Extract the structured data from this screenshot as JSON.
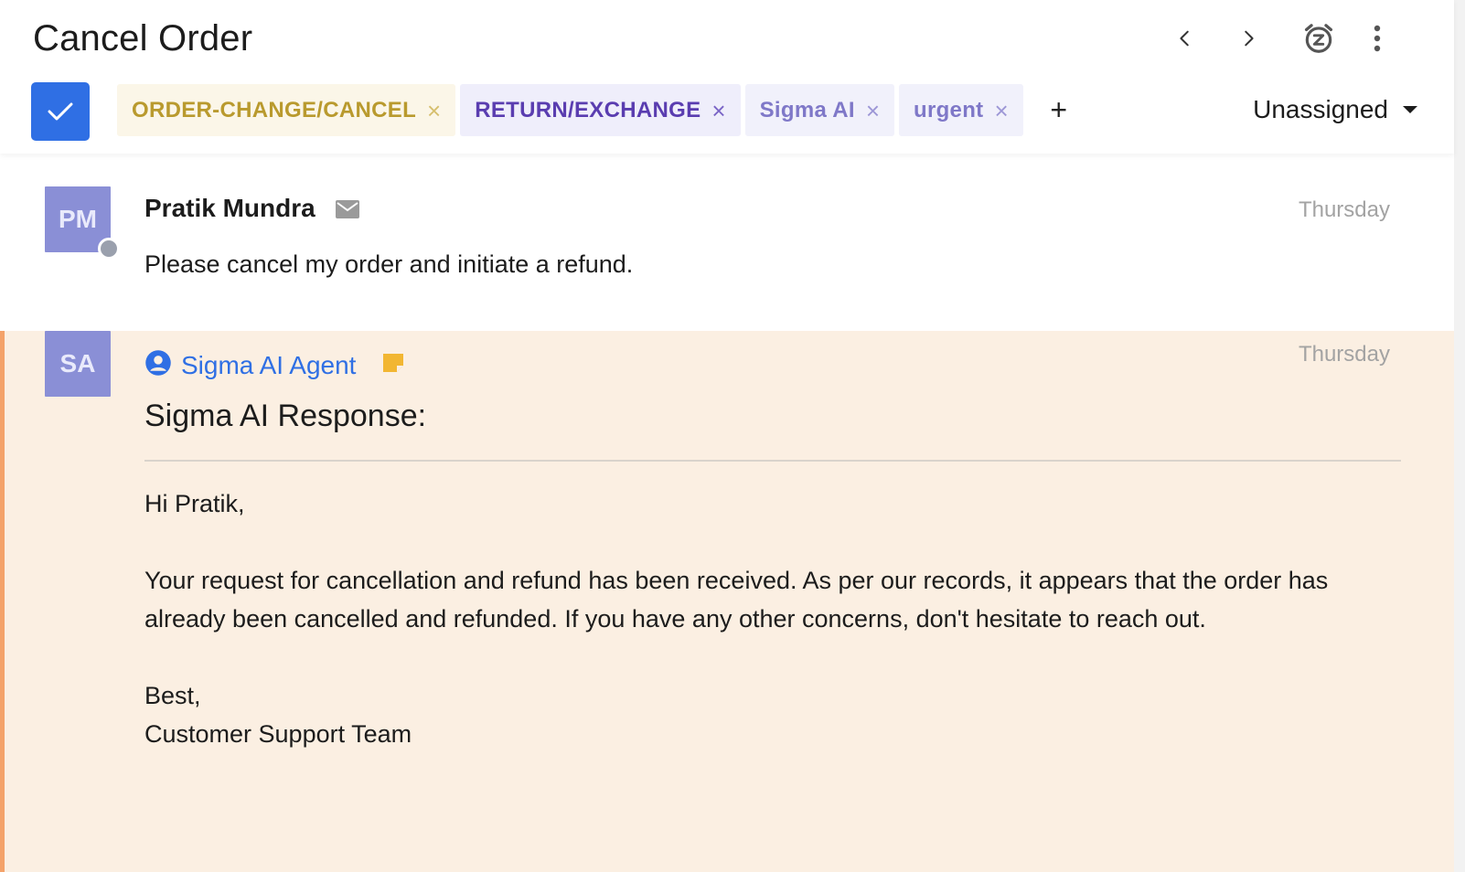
{
  "header": {
    "title": "Cancel Order",
    "icons": [
      "chevron-left-icon",
      "chevron-right-icon",
      "snooze-alarm-icon",
      "more-vertical-icon"
    ],
    "tags": [
      {
        "label": "ORDER-CHANGE/CANCEL",
        "remove": "×"
      },
      {
        "label": "RETURN/EXCHANGE",
        "remove": "×"
      },
      {
        "label": "Sigma AI",
        "remove": "×"
      },
      {
        "label": "urgent",
        "remove": "×"
      }
    ],
    "add_tag": "+",
    "assignee": "Unassigned"
  },
  "messages": [
    {
      "initials": "PM",
      "sender": "Pratik Mundra",
      "channel_icon": "mail-icon",
      "time": "Thursday",
      "body": "Please cancel my order and initiate a refund."
    },
    {
      "initials": "SA",
      "sender": "Sigma AI Agent",
      "sender_icon": "user-circle-icon",
      "note_icon": "note-icon",
      "time": "Thursday",
      "title": "Sigma AI Response:",
      "greeting": "Hi Pratik,",
      "paragraph": "Your request for cancellation and refund has been received. As per our records, it appears that the order has already been cancelled and refunded. If you have any other concerns, don't hesitate to reach out.",
      "signoff": "Best,",
      "signature": "Customer Support Team"
    }
  ],
  "colors": {
    "primary": "#2f6fe4",
    "avatar": "#8a8fd6",
    "note_bg": "#fbefe2",
    "note_border": "#f4a26a",
    "tag_order_text": "#b99a2e",
    "tag_return_text": "#5a3db0",
    "tag_ai_text": "#7f78c8",
    "note_icon": "#f2b632"
  }
}
